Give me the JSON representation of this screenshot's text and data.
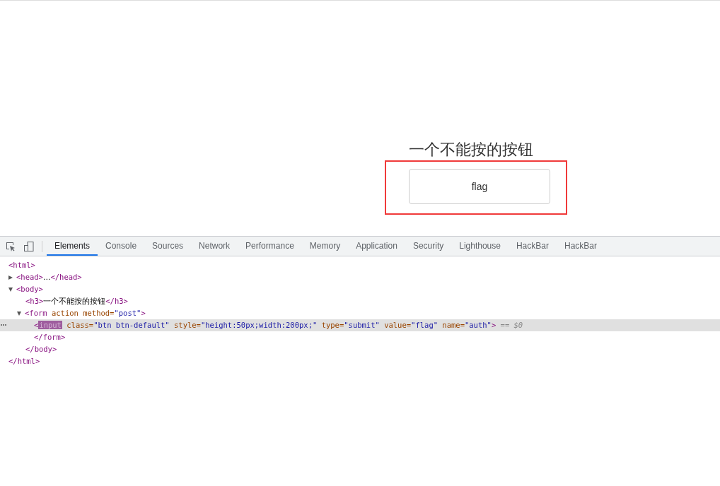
{
  "page": {
    "heading": "一个不能按的按钮",
    "button": "flag",
    "annotation_frame": true
  },
  "devtools": {
    "tabs": [
      {
        "label": "Elements",
        "selected": true
      },
      {
        "label": "Console",
        "selected": false
      },
      {
        "label": "Sources",
        "selected": false
      },
      {
        "label": "Network",
        "selected": false
      },
      {
        "label": "Performance",
        "selected": false
      },
      {
        "label": "Memory",
        "selected": false
      },
      {
        "label": "Application",
        "selected": false
      },
      {
        "label": "Security",
        "selected": false
      },
      {
        "label": "Lighthouse",
        "selected": false
      },
      {
        "label": "HackBar",
        "selected": false
      },
      {
        "label": "HackBar",
        "selected": false
      }
    ],
    "tree": [
      {
        "parts": [
          {
            "kind": "tag",
            "text": "<html>"
          }
        ],
        "selected": false,
        "children": [
          {
            "parts": [
              {
                "kind": "tag",
                "text": "<head>"
              },
              {
                "kind": "text",
                "text": "…"
              },
              {
                "kind": "tag",
                "text": "</head>"
              }
            ],
            "expanded": false,
            "selected": false
          },
          {
            "parts": [
              {
                "kind": "tag",
                "text": "<body>"
              }
            ],
            "expanded": true,
            "selected": false,
            "children": [
              {
                "parts": [
                  {
                    "kind": "tag",
                    "text": "<h3>"
                  },
                  {
                    "kind": "text",
                    "text": "一个不能按的按钮"
                  },
                  {
                    "kind": "tag",
                    "text": "</h3>"
                  }
                ],
                "selected": false
              },
              {
                "parts": [
                  {
                    "kind": "tag",
                    "text": "<form"
                  },
                  {
                    "kind": "attr",
                    "text": " action method="
                  },
                  {
                    "kind": "value",
                    "text": "\"post\""
                  },
                  {
                    "kind": "tag",
                    "text": ">"
                  }
                ],
                "expanded": true,
                "selected": false,
                "children": [
                  {
                    "parts": [
                      {
                        "kind": "tag",
                        "text": "<"
                      },
                      {
                        "kind": "match",
                        "text": "input"
                      },
                      {
                        "kind": "attr",
                        "text": " class="
                      },
                      {
                        "kind": "value",
                        "text": "\"btn btn-default\""
                      },
                      {
                        "kind": "attr",
                        "text": " style="
                      },
                      {
                        "kind": "value",
                        "text": "\"height:50px;width:200px;\""
                      },
                      {
                        "kind": "attr",
                        "text": " type="
                      },
                      {
                        "kind": "value",
                        "text": "\"submit\""
                      },
                      {
                        "kind": "attr",
                        "text": " value="
                      },
                      {
                        "kind": "value",
                        "text": "\"flag\""
                      },
                      {
                        "kind": "attr",
                        "text": " name="
                      },
                      {
                        "kind": "value",
                        "text": "\"auth\""
                      },
                      {
                        "kind": "tag",
                        "text": ">"
                      },
                      {
                        "kind": "note",
                        "text": " == $0"
                      }
                    ],
                    "selected": true
                  }
                ],
                "closing": "</form>"
              }
            ],
            "closing": "</body>"
          }
        ],
        "closing": "</html>"
      }
    ]
  }
}
